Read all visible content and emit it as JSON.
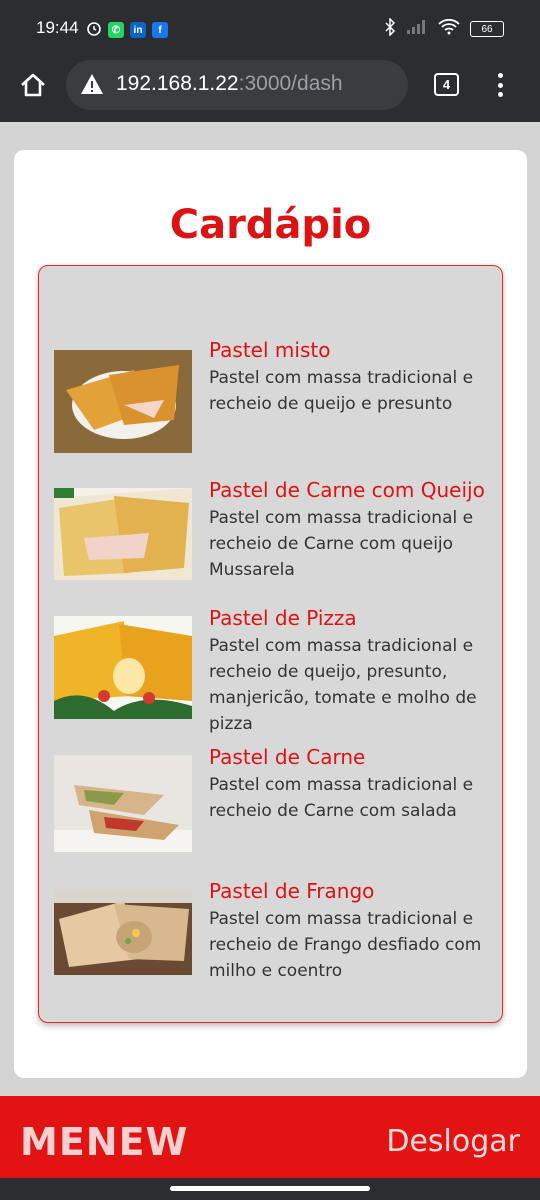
{
  "status_bar": {
    "time": "19:44",
    "battery": "66",
    "left_icons": [
      "alarm-icon",
      "whatsapp-icon",
      "linkedin-icon",
      "facebook-icon"
    ],
    "right_icons": [
      "bluetooth-icon",
      "signal-icon",
      "wifi-icon",
      "battery-icon"
    ]
  },
  "browser": {
    "url_host": "192.168.1.22",
    "url_path": ":3000/dash",
    "tab_count": "4"
  },
  "page": {
    "title": "Cardápio",
    "items": [
      {
        "name": "Pastel misto",
        "description": "Pastel com massa tradicional e recheio de queijo e presunto"
      },
      {
        "name": "Pastel de Carne com Queijo",
        "description": "Pastel com massa tradicional e recheio de Carne com queijo Mussarela"
      },
      {
        "name": "Pastel de Pizza",
        "description": "Pastel com massa tradicional e recheio de queijo, presunto, manjericão, tomate e molho de pizza"
      },
      {
        "name": "Pastel de Carne",
        "description": "Pastel com massa tradicional e recheio de Carne com salada"
      },
      {
        "name": "Pastel de Frango",
        "description": "Pastel com massa tradicional e recheio de Frango desfiado com milho e coentro"
      }
    ]
  },
  "footer": {
    "logo": "MENEW",
    "logout_label": "Deslogar"
  },
  "colors": {
    "accent": "#dd1313",
    "footer_bg": "#e21313",
    "panel_bg": "#d8d8d8"
  }
}
